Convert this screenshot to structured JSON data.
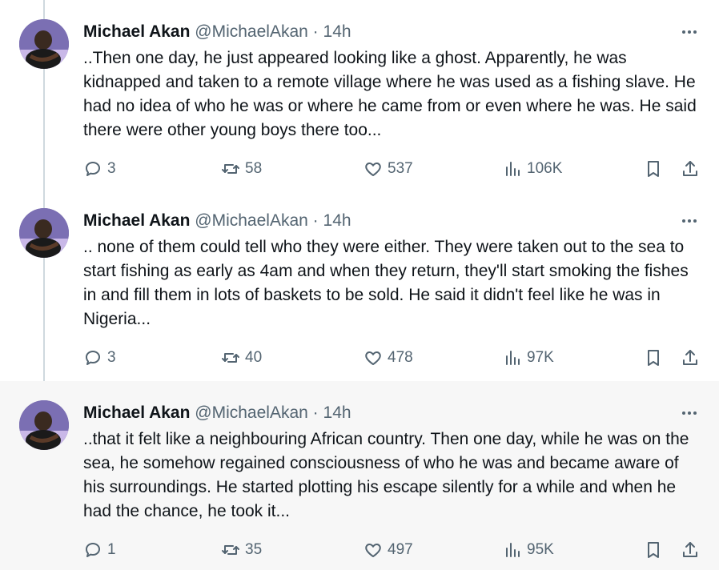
{
  "tweets": [
    {
      "name": "Michael Akan",
      "handle": "@MichaelAkan",
      "separator": "·",
      "time": "14h",
      "text": "..Then one day, he just appeared looking like a ghost. Apparently, he was kidnapped and taken to a remote village where he was used as a fishing slave. He had no idea of who he was or where he came from or even where he was. He said there were other young boys there too...",
      "replies": "3",
      "retweets": "58",
      "likes": "537",
      "views": "106K"
    },
    {
      "name": "Michael Akan",
      "handle": "@MichaelAkan",
      "separator": "·",
      "time": "14h",
      "text": ".. none of them could tell who they were either. They were taken out to the sea to start fishing as early as 4am and when they return, they'll start smoking the fishes in and fill them in lots of baskets to be sold. He said it didn't feel like he was in Nigeria...",
      "replies": "3",
      "retweets": "40",
      "likes": "478",
      "views": "97K"
    },
    {
      "name": "Michael Akan",
      "handle": "@MichaelAkan",
      "separator": "·",
      "time": "14h",
      "text": "..that it felt like a neighbouring African country. Then one day, while he was on the sea, he somehow regained consciousness of who he was and became aware of his surroundings. He started plotting his escape silently for a while and when he had the chance, he took it...",
      "replies": "1",
      "retweets": "35",
      "likes": "497",
      "views": "95K"
    }
  ],
  "icons": {
    "reply": "reply-icon",
    "retweet": "retweet-icon",
    "like": "heart-icon",
    "views": "views-icon",
    "bookmark": "bookmark-icon",
    "share": "share-icon",
    "more": "more-icon"
  },
  "colors": {
    "text": "#0f1419",
    "secondary": "#536471",
    "thread_line": "#cfd9de",
    "highlight_bg": "#f7f7f7"
  }
}
